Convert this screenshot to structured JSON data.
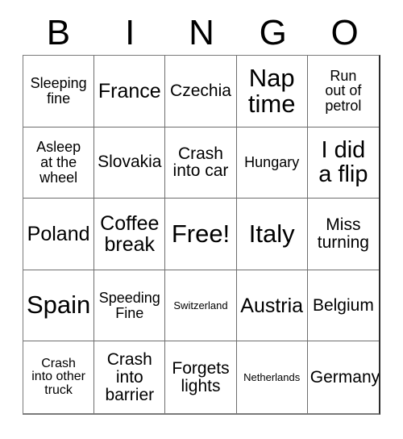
{
  "card": {
    "title": "BINGO",
    "header_letters": [
      "B",
      "I",
      "N",
      "G",
      "O"
    ],
    "grid_size": "5x5",
    "free_space_label": "Free!",
    "colors": {
      "background": "#ffffff",
      "text": "#000000",
      "grid_line": "#6e6e6e",
      "outer_border": "#2b2b2b"
    },
    "rows": [
      [
        {
          "text": "Sleeping\nfine",
          "size": "sm"
        },
        {
          "text": "France",
          "size": "lg"
        },
        {
          "text": "Czechia",
          "size": "md"
        },
        {
          "text": "Nap\ntime",
          "size": "xxl"
        },
        {
          "text": "Run\nout of\npetrol",
          "size": "sm"
        }
      ],
      [
        {
          "text": "Asleep\nat the\nwheel",
          "size": "sm"
        },
        {
          "text": "Slovakia",
          "size": "md"
        },
        {
          "text": "Crash\ninto car",
          "size": "md"
        },
        {
          "text": "Hungary",
          "size": "sm"
        },
        {
          "text": "I did\na flip",
          "size": "xl"
        }
      ],
      [
        {
          "text": "Poland",
          "size": "lg"
        },
        {
          "text": "Coffee\nbreak",
          "size": "lg"
        },
        {
          "text": "Free!",
          "size": "xxl"
        },
        {
          "text": "Italy",
          "size": "xxl"
        },
        {
          "text": "Miss\nturning",
          "size": "md"
        }
      ],
      [
        {
          "text": "Spain",
          "size": "xxl"
        },
        {
          "text": "Speeding\nFine",
          "size": "sm"
        },
        {
          "text": "Switzerland",
          "size": "xxs"
        },
        {
          "text": "Austria",
          "size": "lg"
        },
        {
          "text": "Belgium",
          "size": "md"
        }
      ],
      [
        {
          "text": "Crash\ninto other\ntruck",
          "size": "xs"
        },
        {
          "text": "Crash\ninto\nbarrier",
          "size": "md"
        },
        {
          "text": "Forgets\nlights",
          "size": "md"
        },
        {
          "text": "Netherlands",
          "size": "xxs"
        },
        {
          "text": "Germany",
          "size": "md"
        }
      ]
    ]
  }
}
